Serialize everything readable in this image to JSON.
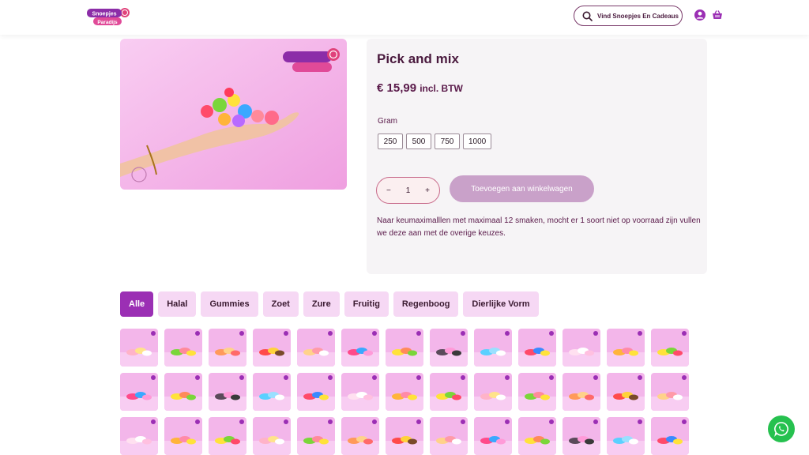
{
  "header": {
    "logo_text_top": "Snoepjes",
    "logo_text_bottom": "Paradijs",
    "search_label": "Vind Snoepjes En Cadeaus",
    "icons": [
      "search-icon",
      "user-icon",
      "cart-icon"
    ]
  },
  "product": {
    "title": "Pick and mix",
    "price": "€ 15,99",
    "price_suffix": "incl. BTW",
    "gram_label": "Gram",
    "variants": [
      "250",
      "500",
      "750",
      "1000"
    ],
    "quantity": "1",
    "add_to_cart": "Toevoegen aan winkelwagen",
    "description": "Naar keumaximalllen met maximaal 12 smaken, mocht er 1 soort niet op voorraad zijn vullen we deze aan met de overige keuzes."
  },
  "filters": [
    "Alle",
    "Halal",
    "Gummies",
    "Zoet",
    "Zure",
    "Fruitig",
    "Regenboog",
    "Dierlijke Vorm"
  ],
  "active_filter": "Alle",
  "colors": {
    "accent": "#9b2fb4",
    "filter_bg": "#f6d8f4",
    "add_button": "#c9a1c9",
    "panel_bg": "#f6f4f6",
    "whatsapp": "#26c14f"
  }
}
